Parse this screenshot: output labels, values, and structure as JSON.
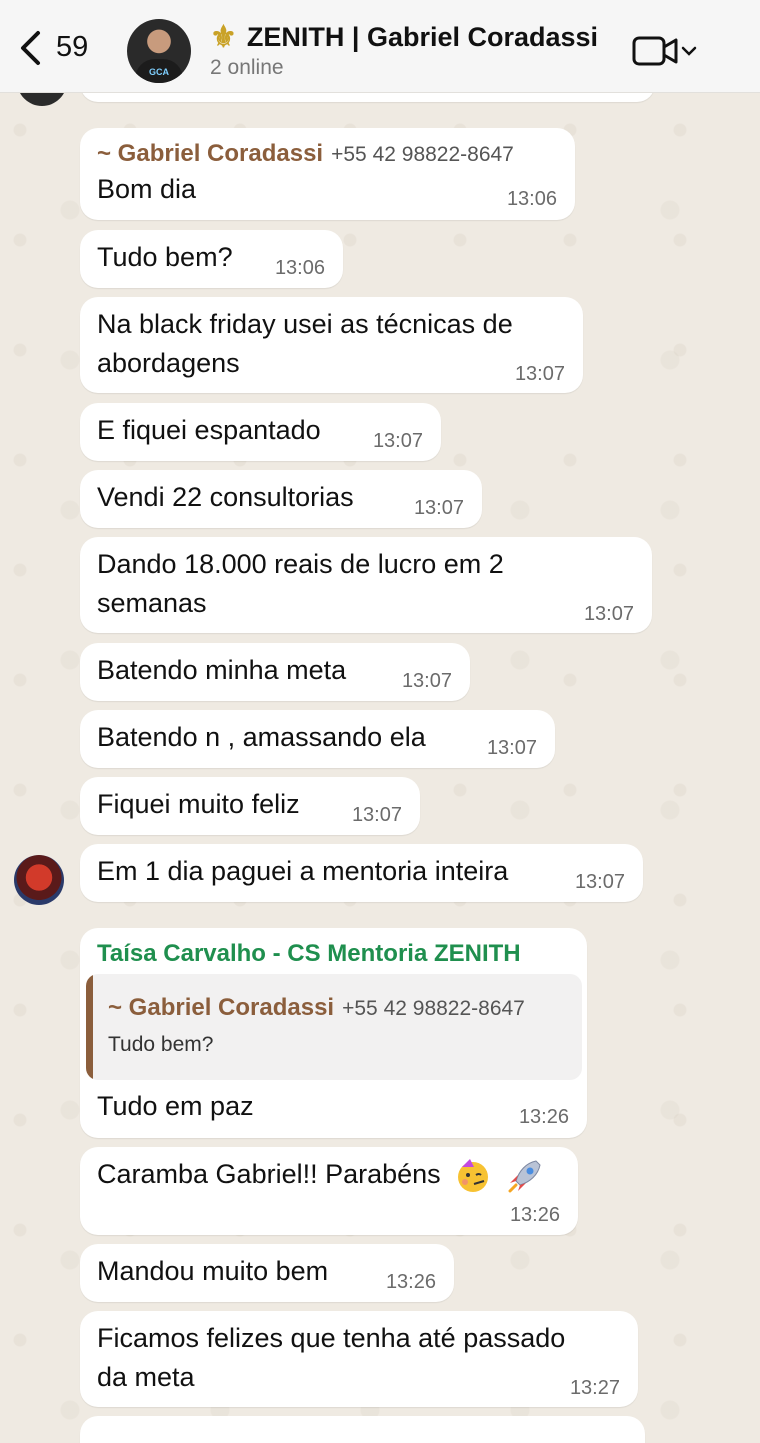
{
  "header": {
    "back_count": "59",
    "group_name": "ZENITH | Gabriel Coradassi",
    "status": "2 online",
    "avatar_text": "GCA",
    "emblem": "⚜"
  },
  "messages": [
    {
      "sender": "~ Gabriel Coradassi",
      "phone": "+55 42 98822-8647",
      "text": "Bom dia",
      "time": "13:06"
    },
    {
      "text": "Tudo bem?",
      "time": "13:06"
    },
    {
      "text_line1": "Na black friday usei as técnicas de",
      "text_line2": "abordagens",
      "time": "13:07"
    },
    {
      "text": "E fiquei espantado",
      "time": "13:07"
    },
    {
      "text": "Vendi 22 consultorias",
      "time": "13:07"
    },
    {
      "text_line1": "Dando 18.000 reais de lucro em 2",
      "text_line2": "semanas",
      "time": "13:07"
    },
    {
      "text": "Batendo minha meta",
      "time": "13:07"
    },
    {
      "text": "Batendo n , amassando ela",
      "time": "13:07"
    },
    {
      "text": "Fiquei muito feliz",
      "time": "13:07"
    },
    {
      "text": "Em 1 dia paguei a mentoria inteira",
      "time": "13:07"
    },
    {
      "sender": "Taísa Carvalho - CS Mentoria ZENITH",
      "quote": {
        "sender": "~ Gabriel Coradassi",
        "phone": "+55 42 98822-8647",
        "text": "Tudo bem?"
      },
      "text": "Tudo em paz",
      "time": "13:26"
    },
    {
      "text": "Caramba Gabriel!! Parabéns",
      "time": "13:26"
    },
    {
      "text": "Mandou muito bem",
      "time": "13:26"
    },
    {
      "text_line1": "Ficamos felizes que tenha até passado",
      "text_line2": "da meta",
      "time": "13:27"
    }
  ],
  "colors": {
    "sender_brown": "#8b5e3c",
    "sender_green": "#1f8f4e",
    "emblem_gold": "#c9a227"
  }
}
